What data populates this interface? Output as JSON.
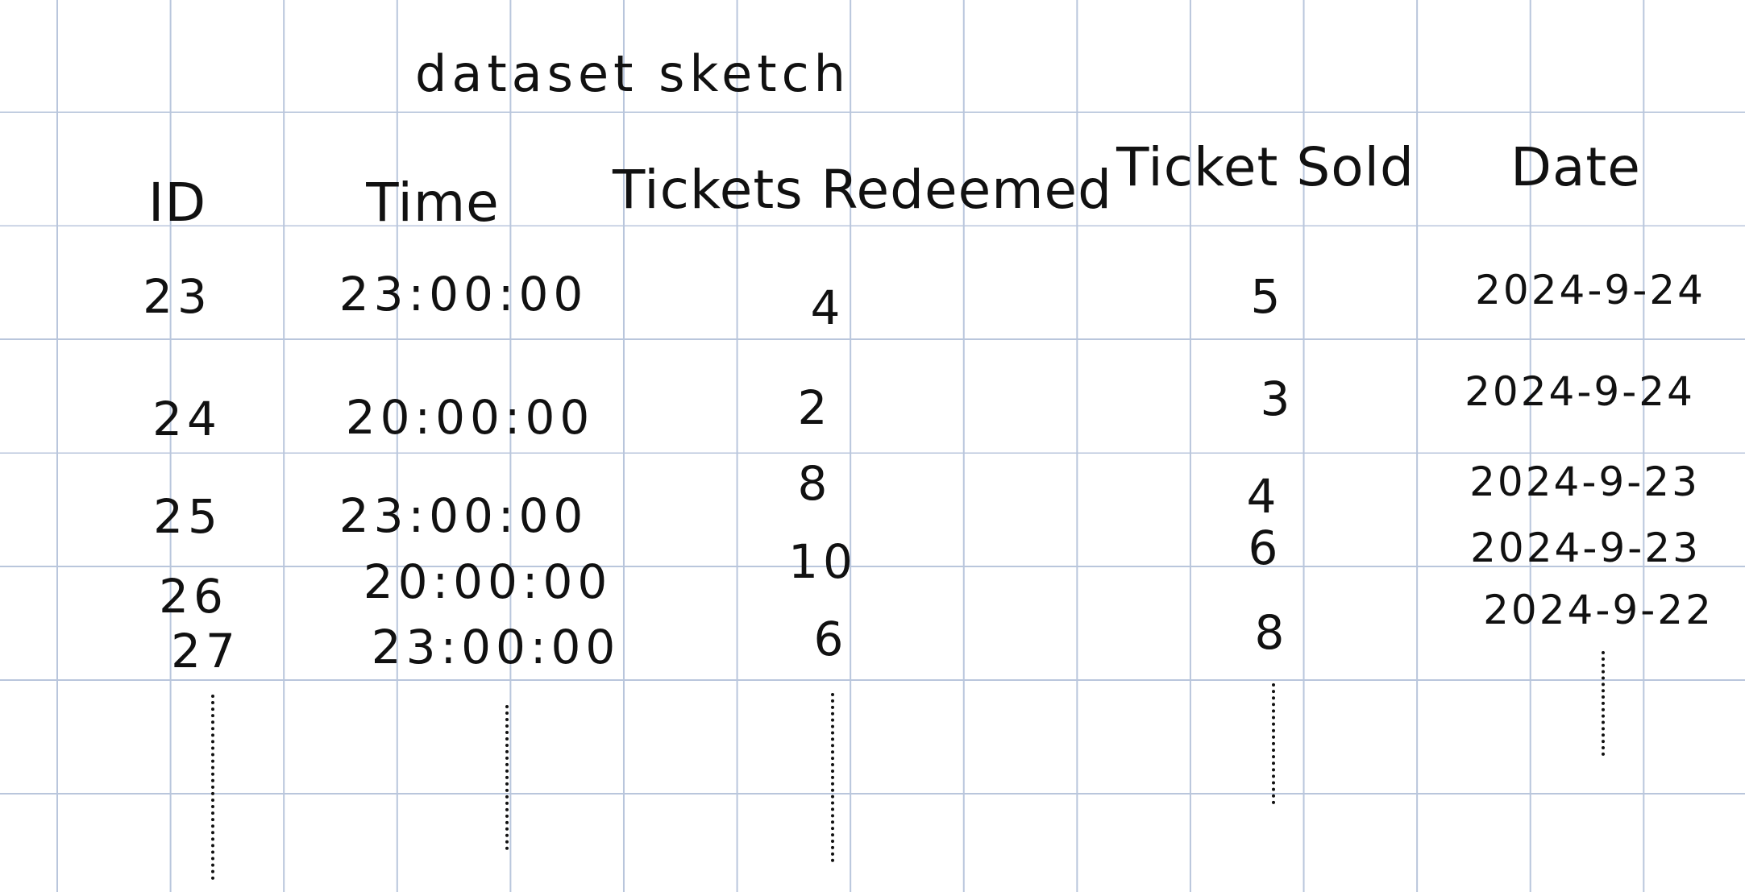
{
  "sketch": {
    "title": "dataset sketch",
    "columns": [
      "ID",
      "Time",
      "Tickets Redeemed",
      "Ticket Sold",
      "Date"
    ],
    "rows": [
      [
        "23",
        "23:00:00",
        "4",
        "5",
        "2024-9-24"
      ],
      [
        "24",
        "20:00:00",
        "2",
        "3",
        "2024-9-24"
      ],
      [
        "25",
        "23:00:00",
        "8",
        "4",
        "2024-9-23"
      ],
      [
        "26",
        "20:00:00",
        "10",
        "6",
        "2024-9-23"
      ],
      [
        "27",
        "23:00:00",
        "6",
        "8",
        "2024-9-22"
      ]
    ]
  }
}
